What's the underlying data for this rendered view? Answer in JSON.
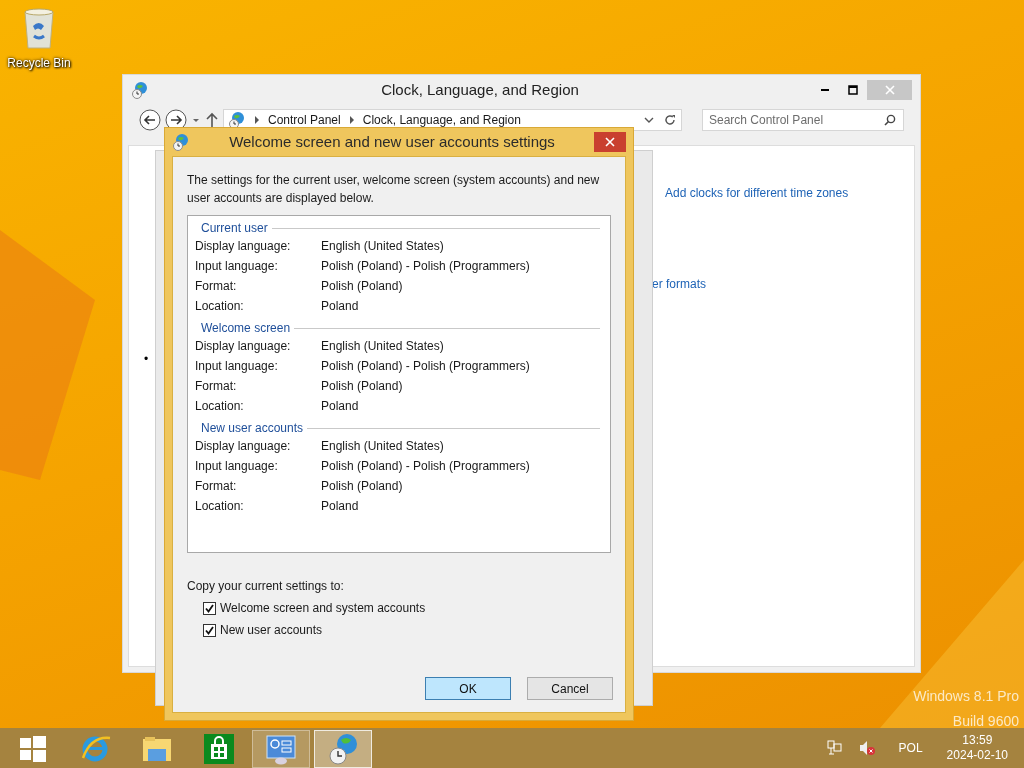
{
  "desktop": {
    "icons": [
      {
        "label": "Recycle Bin"
      }
    ],
    "watermark": [
      "Windows 8.1 Pro",
      "Build 9600"
    ]
  },
  "main_window": {
    "title": "Clock, Language, and Region",
    "breadcrumb": [
      "Control Panel",
      "Clock, Language, and Region"
    ],
    "search": {
      "placeholder": "Search Control Panel"
    },
    "links": [
      "Add clocks for different time zones",
      "er formats"
    ],
    "bullet": "•"
  },
  "dialog": {
    "title": "Welcome screen and new user accounts settings",
    "description": "The settings for the current user, welcome screen (system accounts) and new user accounts are displayed below.",
    "sections": [
      {
        "heading": "Current user",
        "rows": [
          {
            "label": "Display language:",
            "value": "English (United States)"
          },
          {
            "label": "Input language:",
            "value": "Polish (Poland) - Polish (Programmers)"
          },
          {
            "label": "Format:",
            "value": "Polish (Poland)"
          },
          {
            "label": "Location:",
            "value": "Poland"
          }
        ]
      },
      {
        "heading": "Welcome screen",
        "rows": [
          {
            "label": "Display language:",
            "value": "English (United States)"
          },
          {
            "label": "Input language:",
            "value": "Polish (Poland) - Polish (Programmers)"
          },
          {
            "label": "Format:",
            "value": "Polish (Poland)"
          },
          {
            "label": "Location:",
            "value": "Poland"
          }
        ]
      },
      {
        "heading": "New user accounts",
        "rows": [
          {
            "label": "Display language:",
            "value": "English (United States)"
          },
          {
            "label": "Input language:",
            "value": "Polish (Poland) - Polish (Programmers)"
          },
          {
            "label": "Format:",
            "value": "Polish (Poland)"
          },
          {
            "label": "Location:",
            "value": "Poland"
          }
        ]
      }
    ],
    "copy_label": "Copy your current settings to:",
    "options": [
      {
        "label": "Welcome screen and system accounts",
        "checked": true
      },
      {
        "label": "New user accounts",
        "checked": true
      }
    ],
    "buttons": [
      {
        "label": "OK",
        "default": true
      },
      {
        "label": "Cancel",
        "default": false
      }
    ]
  },
  "taskbar": {
    "items": [
      {
        "kind": "start",
        "open": false,
        "selected": false
      },
      {
        "kind": "browser",
        "open": false,
        "selected": false
      },
      {
        "kind": "explorer",
        "open": false,
        "selected": false
      },
      {
        "kind": "store",
        "open": false,
        "selected": false
      },
      {
        "kind": "control-panel",
        "open": true,
        "selected": false
      },
      {
        "kind": "clock-region",
        "open": true,
        "selected": true
      }
    ],
    "tray": {
      "language": "POL",
      "time": "13:59",
      "date": "2024-02-10"
    }
  }
}
